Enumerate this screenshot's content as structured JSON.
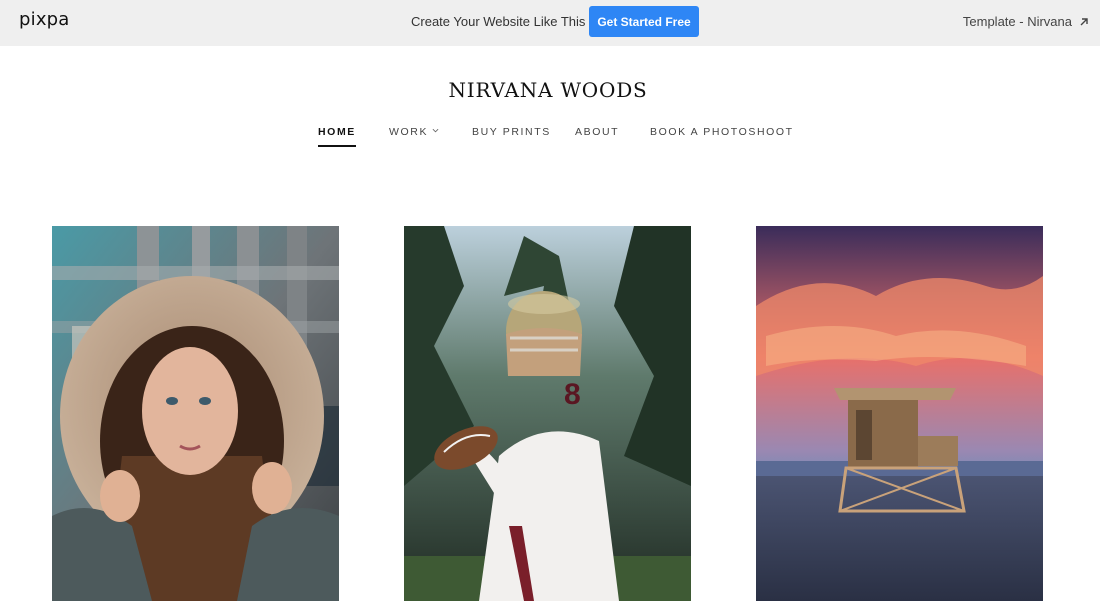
{
  "topbar": {
    "logo": "pixpa",
    "promo_text": "Create Your Website Like This",
    "cta_label": "Get Started Free",
    "template_link": "Template - Nirvana",
    "cta_color": "#2e86f5"
  },
  "site": {
    "title": "NIRVANA WOODS"
  },
  "nav": {
    "items": [
      {
        "label": "HOME",
        "active": true
      },
      {
        "label": "WORK",
        "has_dropdown": true
      },
      {
        "label": "BUY PRINTS"
      },
      {
        "label": "ABOUT"
      },
      {
        "label": "BOOK A PHOTOSHOOT"
      }
    ]
  },
  "gallery": {
    "photos": [
      {
        "icon": "portrait-photo"
      },
      {
        "icon": "football-player-photo"
      },
      {
        "icon": "lifeguard-tower-sunset-photo"
      }
    ]
  }
}
